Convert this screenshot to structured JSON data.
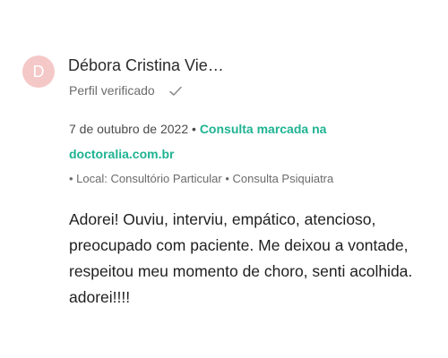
{
  "review": {
    "avatar_initial": "D",
    "author_name": "Débora Cristina Vie…",
    "verified_label": "Perfil verificado",
    "date": "7 de outubro de 2022",
    "separator": " • ",
    "booking_link": "Consulta marcada na doctoralia.com.br",
    "location": "• Local: Consultório Particular • Consulta Psiquiatra",
    "text": "Adorei! Ouviu, interviu, empático, atencioso, preocupado com paciente. Me deixou a vontade, respeitou meu momento de choro, senti acolhida. adorei!!!!"
  },
  "colors": {
    "avatar_bg": "#f5c8c8",
    "link": "#1fb392"
  },
  "icons": {
    "verified": "check-icon"
  }
}
